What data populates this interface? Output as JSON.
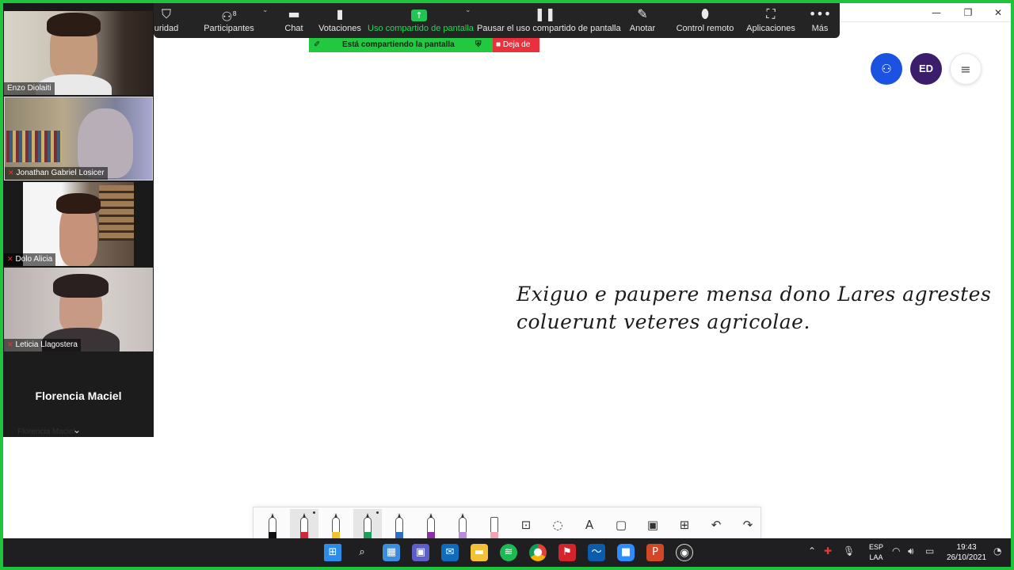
{
  "zoom_toolbar": {
    "security_label": "uridad",
    "participants_label": "Participantes",
    "participants_count": "8",
    "chat_label": "Chat",
    "polls_label": "Votaciones",
    "share_label": "Uso compartido de pantalla",
    "pause_label": "Pausar el uso compartido de pantalla",
    "annotate_label": "Anotar",
    "remote_label": "Control remoto",
    "apps_label": "Aplicaciones",
    "more_label": "Más"
  },
  "sharing_banner": {
    "text": "Está compartiendo la pantalla",
    "stop_label": "Deja de"
  },
  "participants": [
    {
      "name": "Enzo Diolaiti"
    },
    {
      "name": "Jonathan Gabriel Losicer"
    },
    {
      "name": "Dolo Alicia"
    },
    {
      "name": "Leticia Llagostera"
    }
  ],
  "name_only_tile": {
    "big_name": "Florencia Maciel",
    "small_name": "Florencia Maciel"
  },
  "whiteboard": {
    "line1": "Exiguo e paupere mensa dono Lares agrestes",
    "line2": "coluerunt veteres agricolae.",
    "avatar_initials": "ED"
  },
  "pen_toolbar": {
    "text_tool_glyph": "A"
  },
  "taskbar": {
    "lang_line1": "ESP",
    "lang_line2": "LAA",
    "time": "19:43",
    "date": "26/10/2021"
  },
  "colors": {
    "share_border": "#1fc43c",
    "zoom_bar": "#242424",
    "stop_red": "#e8313d",
    "share_user_button": "#1b52e0",
    "avatar_bg": "#3b1d6b"
  }
}
